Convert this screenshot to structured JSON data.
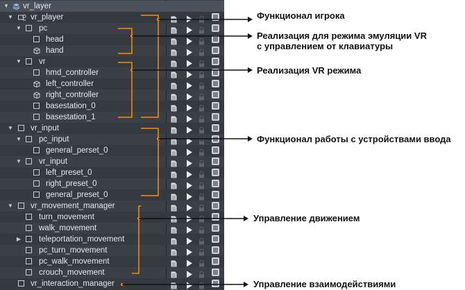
{
  "tree": {
    "rows": [
      {
        "label": "vr_layer",
        "depth": 0,
        "arrow": "down",
        "icon": "layer-icon"
      },
      {
        "label": "vr_player",
        "depth": 1,
        "arrow": "down",
        "icon": "player-icon"
      },
      {
        "label": "pc",
        "depth": 2,
        "arrow": "down",
        "icon": "box-icon"
      },
      {
        "label": "head",
        "depth": 3,
        "arrow": "",
        "icon": "box-icon"
      },
      {
        "label": "hand",
        "depth": 3,
        "arrow": "",
        "icon": "cube-icon"
      },
      {
        "label": "vr",
        "depth": 2,
        "arrow": "down",
        "icon": "box-icon"
      },
      {
        "label": "hmd_controller",
        "depth": 3,
        "arrow": "",
        "icon": "box-icon"
      },
      {
        "label": "left_controller",
        "depth": 3,
        "arrow": "",
        "icon": "cube-icon"
      },
      {
        "label": "right_controller",
        "depth": 3,
        "arrow": "",
        "icon": "cube-icon"
      },
      {
        "label": "basestation_0",
        "depth": 3,
        "arrow": "",
        "icon": "box-icon"
      },
      {
        "label": "basestation_1",
        "depth": 3,
        "arrow": "",
        "icon": "box-icon"
      },
      {
        "label": "vr_input",
        "depth": 1,
        "arrow": "down",
        "icon": "box-icon"
      },
      {
        "label": "pc_input",
        "depth": 2,
        "arrow": "down",
        "icon": "box-icon"
      },
      {
        "label": "general_perset_0",
        "depth": 3,
        "arrow": "",
        "icon": "box-icon"
      },
      {
        "label": "vr_input",
        "depth": 2,
        "arrow": "down",
        "icon": "box-icon"
      },
      {
        "label": "left_preset_0",
        "depth": 3,
        "arrow": "",
        "icon": "box-icon"
      },
      {
        "label": "right_preset_0",
        "depth": 3,
        "arrow": "",
        "icon": "box-icon"
      },
      {
        "label": "general_preset_0",
        "depth": 3,
        "arrow": "",
        "icon": "box-icon"
      },
      {
        "label": "vr_movement_manager",
        "depth": 1,
        "arrow": "down",
        "icon": "box-icon"
      },
      {
        "label": "turn_movement",
        "depth": 2,
        "arrow": "",
        "icon": "box-icon"
      },
      {
        "label": "walk_movement",
        "depth": 2,
        "arrow": "",
        "icon": "box-icon"
      },
      {
        "label": "teleportation_movement",
        "depth": 2,
        "arrow": "right",
        "icon": "box-icon"
      },
      {
        "label": "pc_turn_movement",
        "depth": 2,
        "arrow": "",
        "icon": "box-icon"
      },
      {
        "label": "pc_walk_movement",
        "depth": 2,
        "arrow": "",
        "icon": "box-icon"
      },
      {
        "label": "crouch_movement",
        "depth": 2,
        "arrow": "",
        "icon": "box-icon"
      },
      {
        "label": "vr_interaction_manager",
        "depth": 1,
        "arrow": "",
        "icon": "box-icon"
      }
    ],
    "column_icons": [
      "page-icon",
      "play-icon",
      "lock-icon",
      "checkbox-icon"
    ]
  },
  "annotations": [
    {
      "text": "Функционал игрока"
    },
    {
      "text": "Реализация для режима эмуляции VR"
    },
    {
      "text": "с управлением от клавиатуры"
    },
    {
      "text": "Реализация VR режима"
    },
    {
      "text": "Функционал работы с устройствами ввода"
    },
    {
      "text": "Управление движением"
    },
    {
      "text": "Управление взаимодействиями"
    }
  ],
  "colors": {
    "panel": "#3b4046",
    "bracket": "#ff8c00",
    "arrow_line": "#111111"
  }
}
